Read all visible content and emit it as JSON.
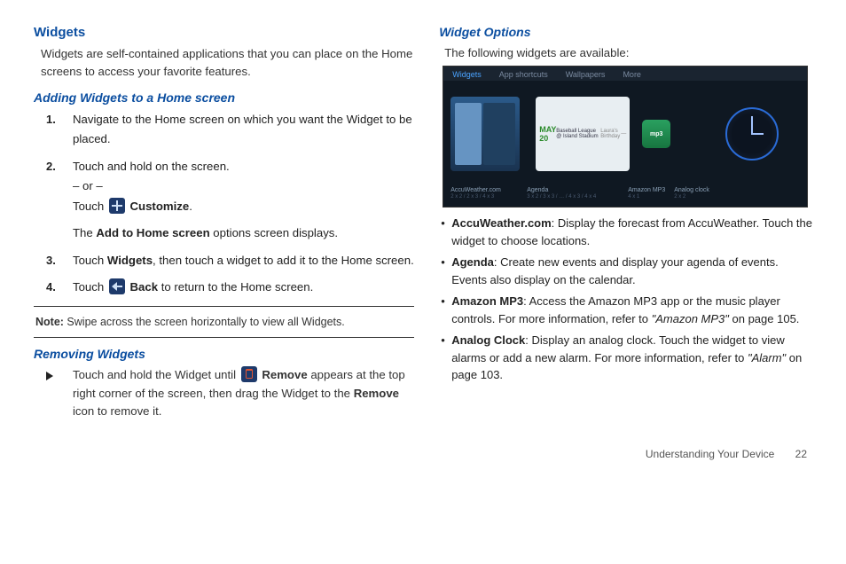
{
  "left": {
    "h_widgets": "Widgets",
    "widgets_intro": "Widgets are self-contained applications that you can place on the Home screens to access your favorite features.",
    "h_adding": "Adding Widgets to a Home screen",
    "step1": "Navigate to the Home screen on which you want the Widget to be placed.",
    "step2a": "Touch and hold on the screen.",
    "step2_or": "– or –",
    "step2b_pre": "Touch ",
    "step2b_label": " Customize",
    "step2b_post": ".",
    "step2c_pre": "The ",
    "step2c_bold": "Add to Home screen",
    "step2c_post": " options screen displays.",
    "step3_pre": "Touch ",
    "step3_bold": "Widgets",
    "step3_post": ", then touch a widget to add it to the Home screen.",
    "step4_pre": "Touch ",
    "step4_label": " Back",
    "step4_post": " to return to the Home screen.",
    "note_label": "Note:",
    "note_text": " Swipe across the screen horizontally to view all Widgets.",
    "h_removing": "Removing Widgets",
    "remove_pre": "Touch and hold the Widget until ",
    "remove_bold1": " Remove",
    "remove_mid": " appears at the top right corner of the screen, then drag the Widget to the ",
    "remove_bold2": "Remove",
    "remove_post": " icon to remove it."
  },
  "right": {
    "h_options": "Widget Options",
    "options_intro": "The following widgets are available:",
    "tabs": {
      "widgets": "Widgets",
      "apps": "App shortcuts",
      "wall": "Wallpapers",
      "more": "More"
    },
    "tiles": {
      "accu": {
        "name": "AccuWeather.com",
        "sub": "2 x 2 / 2 x 3 / 4 x 3"
      },
      "agenda": {
        "name": "Agenda",
        "sub": "3 x 2 / 3 x 3 / … / 4 x 3 / 4 x 4",
        "date": "MAY 20"
      },
      "mp3": {
        "name": "Amazon MP3",
        "sub": "4 x 1",
        "icon": "mp3"
      },
      "clock": {
        "name": "Analog clock",
        "sub": "2 x 2"
      }
    },
    "b1_bold": "AccuWeather.com",
    "b1_text": ": Display the forecast from AccuWeather. Touch the widget to choose locations.",
    "b2_bold": "Agenda",
    "b2_text": ": Create new events and display your agenda of events. Events also display on the calendar.",
    "b3_bold": "Amazon MP3",
    "b3_text_a": ": Access the Amazon MP3 app or the music player controls. For more information, refer to ",
    "b3_ref": "\"Amazon MP3\"",
    "b3_text_b": "  on page 105.",
    "b4_bold": "Analog Clock",
    "b4_text_a": ": Display an analog clock. Touch the widget to view alarms or add a new alarm. For more information, refer to ",
    "b4_ref": "\"Alarm\"",
    "b4_text_b": "  on page 103."
  },
  "footer": {
    "section": "Understanding Your Device",
    "page": "22"
  }
}
